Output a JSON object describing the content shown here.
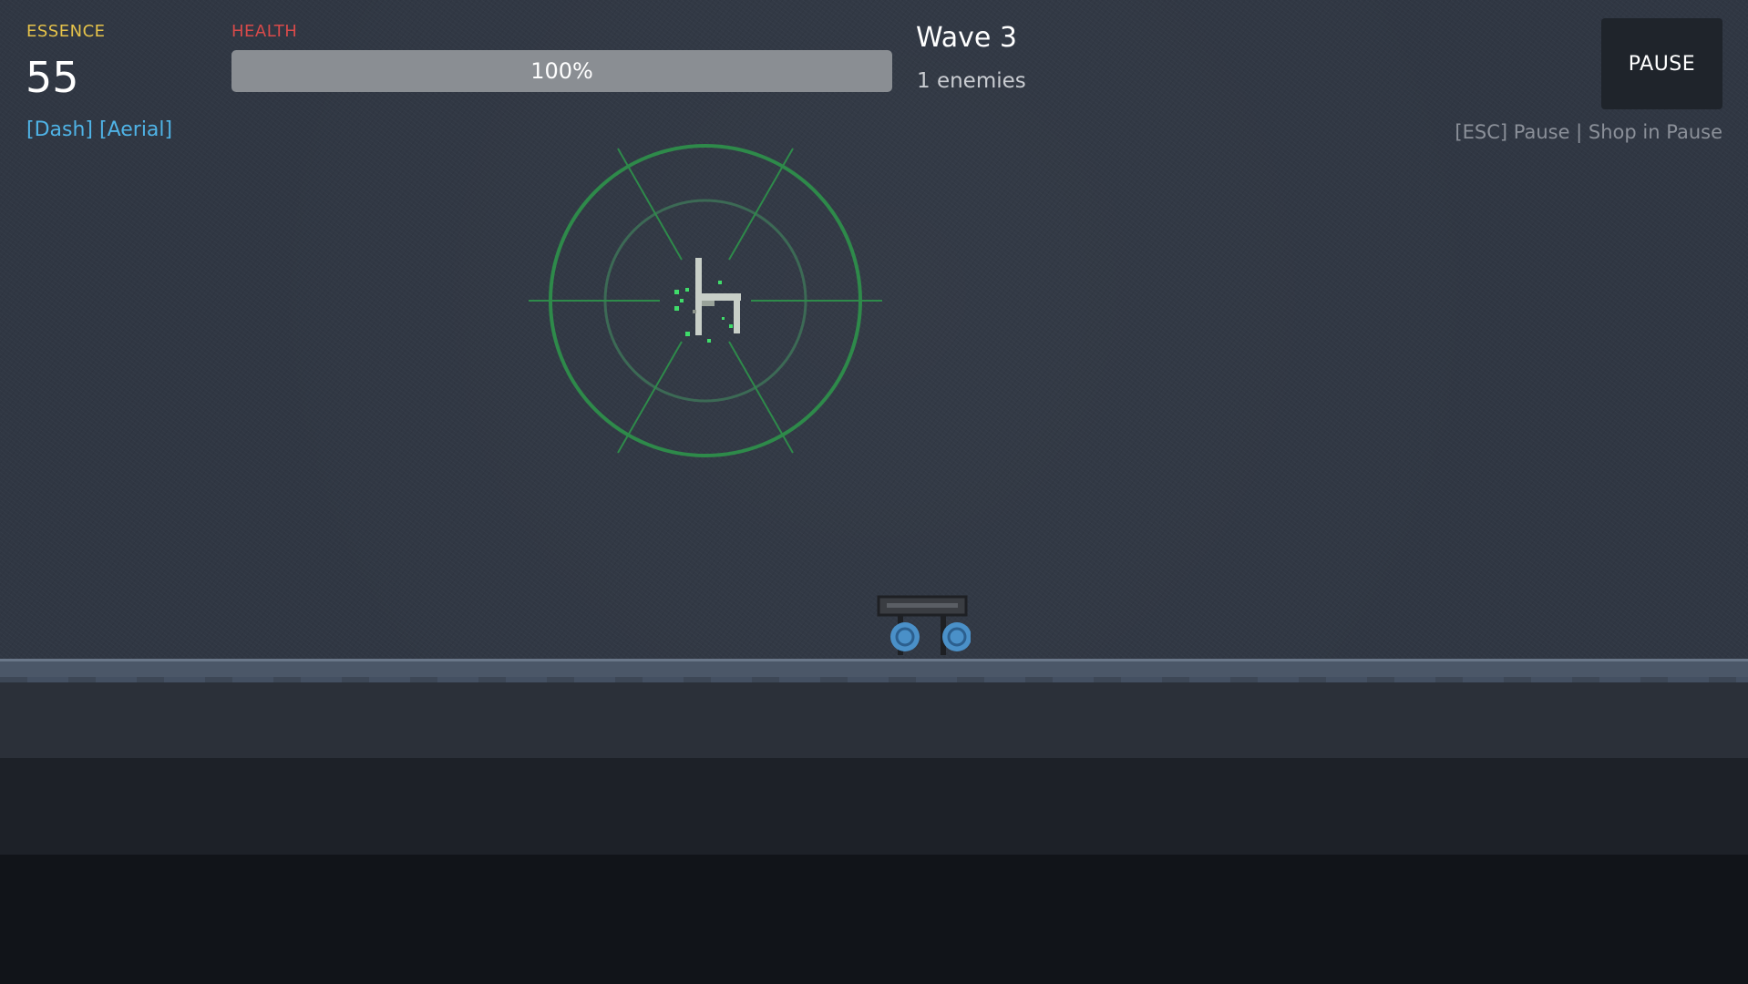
{
  "hud": {
    "essence_label": "ESSENCE",
    "essence_value": "55",
    "abilities": "[Dash] [Aerial]",
    "health_label": "HEALTH",
    "health_text": "100%",
    "health_fraction": 1.0,
    "wave_title": "Wave 3",
    "enemies_count": "1 enemies",
    "pause_label": "PAUSE",
    "hint": "[ESC] Pause | Shop in Pause"
  },
  "colors": {
    "essence": "#e6c34a",
    "health": "#d84a4a",
    "abilities": "#4fb3e6",
    "reticle": "#2e8a4a",
    "enemy": "#4a90c8"
  },
  "sprites": {
    "player": "player-character-icon",
    "reticle": "targeting-reticle-icon",
    "enemy": "wheeled-enemy-icon"
  }
}
